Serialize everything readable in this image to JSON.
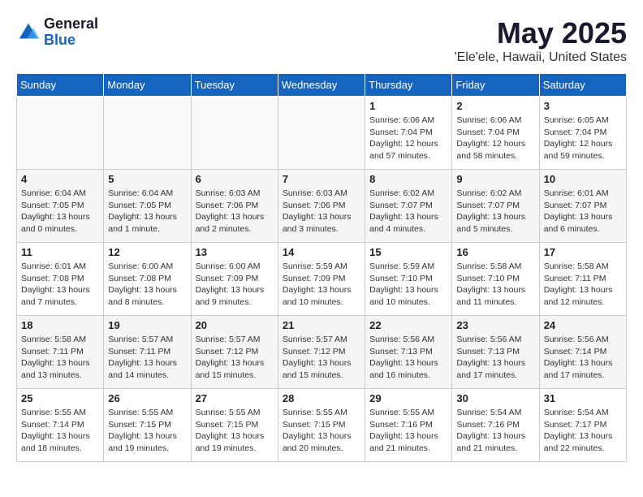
{
  "header": {
    "logo_line1": "General",
    "logo_line2": "Blue",
    "month": "May 2025",
    "location": "'Ele'ele, Hawaii, United States"
  },
  "weekdays": [
    "Sunday",
    "Monday",
    "Tuesday",
    "Wednesday",
    "Thursday",
    "Friday",
    "Saturday"
  ],
  "weeks": [
    [
      {
        "day": "",
        "info": ""
      },
      {
        "day": "",
        "info": ""
      },
      {
        "day": "",
        "info": ""
      },
      {
        "day": "",
        "info": ""
      },
      {
        "day": "1",
        "info": "Sunrise: 6:06 AM\nSunset: 7:04 PM\nDaylight: 12 hours\nand 57 minutes."
      },
      {
        "day": "2",
        "info": "Sunrise: 6:06 AM\nSunset: 7:04 PM\nDaylight: 12 hours\nand 58 minutes."
      },
      {
        "day": "3",
        "info": "Sunrise: 6:05 AM\nSunset: 7:04 PM\nDaylight: 12 hours\nand 59 minutes."
      }
    ],
    [
      {
        "day": "4",
        "info": "Sunrise: 6:04 AM\nSunset: 7:05 PM\nDaylight: 13 hours\nand 0 minutes."
      },
      {
        "day": "5",
        "info": "Sunrise: 6:04 AM\nSunset: 7:05 PM\nDaylight: 13 hours\nand 1 minute."
      },
      {
        "day": "6",
        "info": "Sunrise: 6:03 AM\nSunset: 7:06 PM\nDaylight: 13 hours\nand 2 minutes."
      },
      {
        "day": "7",
        "info": "Sunrise: 6:03 AM\nSunset: 7:06 PM\nDaylight: 13 hours\nand 3 minutes."
      },
      {
        "day": "8",
        "info": "Sunrise: 6:02 AM\nSunset: 7:07 PM\nDaylight: 13 hours\nand 4 minutes."
      },
      {
        "day": "9",
        "info": "Sunrise: 6:02 AM\nSunset: 7:07 PM\nDaylight: 13 hours\nand 5 minutes."
      },
      {
        "day": "10",
        "info": "Sunrise: 6:01 AM\nSunset: 7:07 PM\nDaylight: 13 hours\nand 6 minutes."
      }
    ],
    [
      {
        "day": "11",
        "info": "Sunrise: 6:01 AM\nSunset: 7:08 PM\nDaylight: 13 hours\nand 7 minutes."
      },
      {
        "day": "12",
        "info": "Sunrise: 6:00 AM\nSunset: 7:08 PM\nDaylight: 13 hours\nand 8 minutes."
      },
      {
        "day": "13",
        "info": "Sunrise: 6:00 AM\nSunset: 7:09 PM\nDaylight: 13 hours\nand 9 minutes."
      },
      {
        "day": "14",
        "info": "Sunrise: 5:59 AM\nSunset: 7:09 PM\nDaylight: 13 hours\nand 10 minutes."
      },
      {
        "day": "15",
        "info": "Sunrise: 5:59 AM\nSunset: 7:10 PM\nDaylight: 13 hours\nand 10 minutes."
      },
      {
        "day": "16",
        "info": "Sunrise: 5:58 AM\nSunset: 7:10 PM\nDaylight: 13 hours\nand 11 minutes."
      },
      {
        "day": "17",
        "info": "Sunrise: 5:58 AM\nSunset: 7:11 PM\nDaylight: 13 hours\nand 12 minutes."
      }
    ],
    [
      {
        "day": "18",
        "info": "Sunrise: 5:58 AM\nSunset: 7:11 PM\nDaylight: 13 hours\nand 13 minutes."
      },
      {
        "day": "19",
        "info": "Sunrise: 5:57 AM\nSunset: 7:11 PM\nDaylight: 13 hours\nand 14 minutes."
      },
      {
        "day": "20",
        "info": "Sunrise: 5:57 AM\nSunset: 7:12 PM\nDaylight: 13 hours\nand 15 minutes."
      },
      {
        "day": "21",
        "info": "Sunrise: 5:57 AM\nSunset: 7:12 PM\nDaylight: 13 hours\nand 15 minutes."
      },
      {
        "day": "22",
        "info": "Sunrise: 5:56 AM\nSunset: 7:13 PM\nDaylight: 13 hours\nand 16 minutes."
      },
      {
        "day": "23",
        "info": "Sunrise: 5:56 AM\nSunset: 7:13 PM\nDaylight: 13 hours\nand 17 minutes."
      },
      {
        "day": "24",
        "info": "Sunrise: 5:56 AM\nSunset: 7:14 PM\nDaylight: 13 hours\nand 17 minutes."
      }
    ],
    [
      {
        "day": "25",
        "info": "Sunrise: 5:55 AM\nSunset: 7:14 PM\nDaylight: 13 hours\nand 18 minutes."
      },
      {
        "day": "26",
        "info": "Sunrise: 5:55 AM\nSunset: 7:15 PM\nDaylight: 13 hours\nand 19 minutes."
      },
      {
        "day": "27",
        "info": "Sunrise: 5:55 AM\nSunset: 7:15 PM\nDaylight: 13 hours\nand 19 minutes."
      },
      {
        "day": "28",
        "info": "Sunrise: 5:55 AM\nSunset: 7:15 PM\nDaylight: 13 hours\nand 20 minutes."
      },
      {
        "day": "29",
        "info": "Sunrise: 5:55 AM\nSunset: 7:16 PM\nDaylight: 13 hours\nand 21 minutes."
      },
      {
        "day": "30",
        "info": "Sunrise: 5:54 AM\nSunset: 7:16 PM\nDaylight: 13 hours\nand 21 minutes."
      },
      {
        "day": "31",
        "info": "Sunrise: 5:54 AM\nSunset: 7:17 PM\nDaylight: 13 hours\nand 22 minutes."
      }
    ]
  ]
}
